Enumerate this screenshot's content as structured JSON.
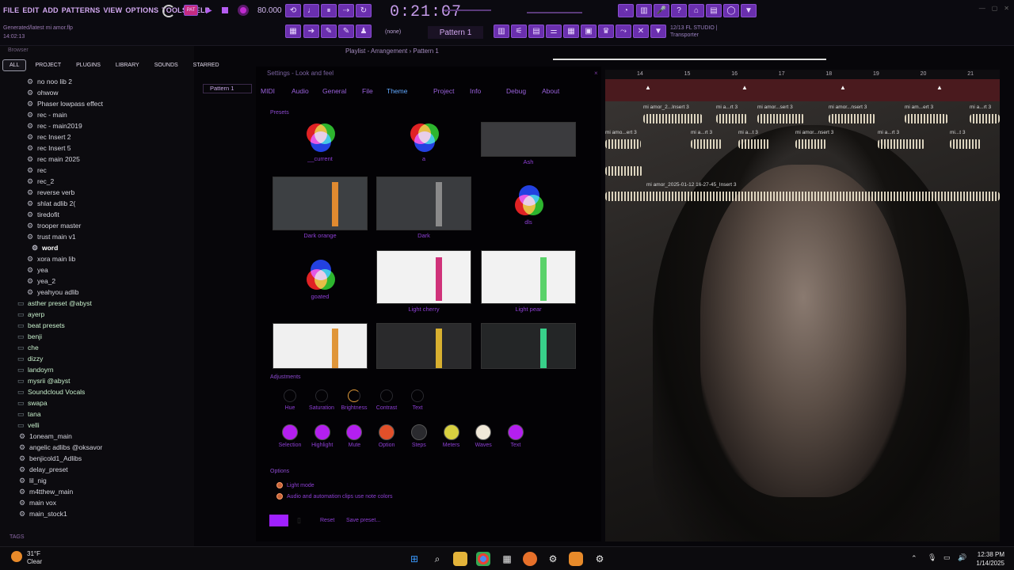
{
  "menubar": {
    "items": [
      "FILE",
      "EDIT",
      "ADD",
      "PATTERNS",
      "VIEW",
      "OPTIONS",
      "TOOLS",
      "HELP"
    ]
  },
  "project": {
    "line1": "Generated/latest mi amor.flp",
    "line2": "14:02:13"
  },
  "transport": {
    "tempo": "80.000",
    "time": "0:21:07",
    "pattern": "Pattern 1",
    "pattern_mode": "(none)",
    "info": "12/13 FL STUDIO |",
    "info2": "Transporter"
  },
  "browser": {
    "header": "Browser",
    "tabs": [
      "ALL",
      "PROJECT",
      "PLUGINS",
      "LIBRARY",
      "SOUNDS",
      "STARRED"
    ],
    "items": [
      {
        "label": "no noo lib 2",
        "type": "preset"
      },
      {
        "label": "ohwow",
        "type": "preset"
      },
      {
        "label": "Phaser lowpass effect",
        "type": "preset"
      },
      {
        "label": "rec - main",
        "type": "preset"
      },
      {
        "label": "rec - main2019",
        "type": "preset"
      },
      {
        "label": "rec Insert 2",
        "type": "preset"
      },
      {
        "label": "rec Insert 5",
        "type": "preset"
      },
      {
        "label": "rec main 2025",
        "type": "preset"
      },
      {
        "label": "rec",
        "type": "preset"
      },
      {
        "label": "rec_2",
        "type": "preset"
      },
      {
        "label": "reverse verb",
        "type": "preset"
      },
      {
        "label": "shlat adlib 2(",
        "type": "preset"
      },
      {
        "label": "tiredofit",
        "type": "preset"
      },
      {
        "label": "trooper master",
        "type": "preset"
      },
      {
        "label": "trust main v1",
        "type": "preset"
      },
      {
        "label": "word",
        "type": "preset-selected"
      },
      {
        "label": "xora main lib",
        "type": "preset"
      },
      {
        "label": "yea",
        "type": "preset"
      },
      {
        "label": "yea_2",
        "type": "preset"
      },
      {
        "label": "yeahyou adlib",
        "type": "preset"
      },
      {
        "label": "asther preset @abyst",
        "type": "folder"
      },
      {
        "label": "ayerp",
        "type": "folder"
      },
      {
        "label": "beat presets",
        "type": "folder"
      },
      {
        "label": "benji",
        "type": "folder"
      },
      {
        "label": "che",
        "type": "folder"
      },
      {
        "label": "dizzy",
        "type": "folder"
      },
      {
        "label": "landoyrn",
        "type": "folder"
      },
      {
        "label": "mysrii @abyst",
        "type": "folder"
      },
      {
        "label": "Soundcloud Vocals",
        "type": "folder"
      },
      {
        "label": "swapa",
        "type": "folder"
      },
      {
        "label": "tana",
        "type": "folder"
      },
      {
        "label": "velli",
        "type": "folder"
      },
      {
        "label": "1oneam_main",
        "type": "root"
      },
      {
        "label": "angelic adlibs @oksavor",
        "type": "root"
      },
      {
        "label": "benjicold1_Adlibs",
        "type": "root"
      },
      {
        "label": "delay_preset",
        "type": "root"
      },
      {
        "label": "lil_nig",
        "type": "root"
      },
      {
        "label": "m4tthew_main",
        "type": "root"
      },
      {
        "label": "main vox",
        "type": "root"
      },
      {
        "label": "main_stock1",
        "type": "root"
      }
    ],
    "tags_label": "TAGS"
  },
  "playlist": {
    "title": "Playlist - Arrangement › Pattern 1",
    "pattern_item": "Pattern 1"
  },
  "settings": {
    "title": "Settings - Look and feel",
    "tabs": [
      "MIDI",
      "Audio",
      "General",
      "File",
      "Theme",
      "Project",
      "Info",
      "Debug",
      "About"
    ],
    "active_tab": "Theme",
    "presets_label": "Presets",
    "presets": [
      "__current",
      "a",
      "Ash",
      "Dark orange",
      "Dark",
      "dls",
      "goated",
      "Light cherry",
      "Light pear",
      "",
      "",
      ""
    ],
    "adjustments_label": "Adjustments",
    "knobs": [
      "Hue",
      "Saturation",
      "Brightness",
      "Contrast",
      "Text"
    ],
    "swatches": [
      {
        "label": "Selection",
        "color": "#b41ff0"
      },
      {
        "label": "Highlight",
        "color": "#b41ff0"
      },
      {
        "label": "Mute",
        "color": "#b41ff0"
      },
      {
        "label": "Option",
        "color": "#e2502a"
      },
      {
        "label": "Steps",
        "color": "#2a2a2e"
      },
      {
        "label": "Meters",
        "color": "#d8d040"
      },
      {
        "label": "Waves",
        "color": "#f0e8d8"
      },
      {
        "label": "Text",
        "color": "#b41ff0"
      }
    ],
    "options_label": "Options",
    "options": [
      "Light mode",
      "Audio and automation clips use note colors"
    ],
    "bottom": {
      "reset": "Reset",
      "save": "Save preset..."
    }
  },
  "arrangement": {
    "ruler": [
      "14",
      "15",
      "16",
      "17",
      "18",
      "19",
      "20",
      "21"
    ],
    "clips": [
      "mi amor_2...Insert 3",
      "mi a...rt 3",
      "mi amor...sert 3",
      "mi amor...nsert 3",
      "mi am...ert 3",
      "mi a...rt 3",
      "mi amo...ert 3",
      "mi a...rt 3",
      "mi a...t 3",
      "mi amor...nsert 3",
      "mi a...rt 3",
      "mi...t 3",
      "mi amor_2025-01-12 16-27-45_Insert 3"
    ]
  },
  "taskbar": {
    "temp": "31°F",
    "weather": "Clear",
    "time": "12:38 PM",
    "date": "1/14/2025"
  }
}
